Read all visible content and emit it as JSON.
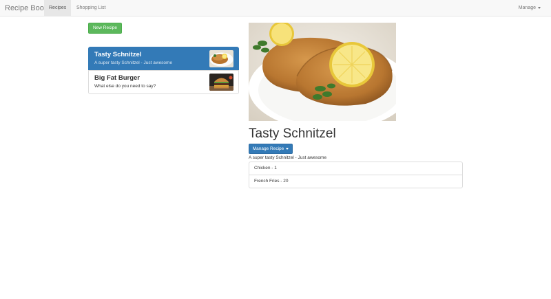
{
  "navbar": {
    "brand": "Recipe Book",
    "links": [
      {
        "label": "Recipes",
        "active": true
      },
      {
        "label": "Shopping List",
        "active": false
      }
    ],
    "manage_label": "Manage"
  },
  "sidebar": {
    "new_recipe_label": "New Recipe",
    "recipes": [
      {
        "name": "Tasty Schnitzel",
        "description": "A super tasty Schnitzel - Just awesome",
        "active": true,
        "thumb": "schnitzel"
      },
      {
        "name": "Big Fat Burger",
        "description": "What else do you need to say?",
        "active": false,
        "thumb": "burger"
      }
    ]
  },
  "detail": {
    "image": "schnitzel",
    "title": "Tasty Schnitzel",
    "manage_label": "Manage Recipe",
    "description": "A super tasty Schnitzel - Just awesome",
    "ingredients": [
      "Chicken - 1",
      "French Fries - 20"
    ]
  },
  "colors": {
    "primary": "#337ab7",
    "success": "#5cb85c",
    "navbar_bg": "#f8f8f8"
  }
}
